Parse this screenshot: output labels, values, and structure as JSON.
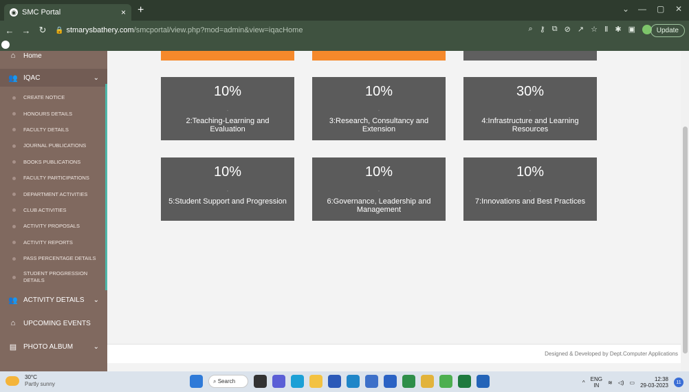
{
  "browser": {
    "tab_title": "SMC Portal",
    "tab_close": "×",
    "new_tab": "+",
    "url_domain": "stmarysbathery.com",
    "url_path": "/smcportal/view.php?mod=admin&view=iqacHome",
    "update_label": "Update",
    "window_controls": {
      "chevron": "⌄",
      "minimize": "—",
      "maximize": "▢",
      "close": "✕"
    }
  },
  "sidebar": {
    "home_label": "Home",
    "iqac_label": "IQAC",
    "iqac_items": [
      "CREATE NOTICE",
      "HONOURS DETAILS",
      "FACULTY DETAILS",
      "JOURNAL PUBLICATIONS",
      "BOOKS PUBLICATIONS",
      "FACULTY PARTICIPATIONS",
      "DEPARTMENT ACTIVITIES",
      "CLUB ACTIVITIES",
      "ACTIVITY PROPOSALS",
      "ACTIVITY REPORTS",
      "PASS PERCENTAGE DETAILS",
      "STUDENT PROGRESSION DETAILS"
    ],
    "activity_details_label": "ACTIVITY DETAILS",
    "upcoming_events_label": "UPCOMING EVENTS",
    "photo_album_label": "PHOTO ALBUM"
  },
  "main": {
    "criteria": [
      {
        "percent": "10%",
        "separator": "-",
        "name": "2:Teaching-Learning and Evaluation"
      },
      {
        "percent": "10%",
        "separator": "-",
        "name": "3:Research, Consultancy and Extension"
      },
      {
        "percent": "30%",
        "separator": "-",
        "name": "4:Infrastructure and Learning Resources"
      },
      {
        "percent": "10%",
        "separator": "-",
        "name": "5:Student Support and Progression"
      },
      {
        "percent": "10%",
        "separator": "-",
        "name": "6:Governance, Leadership and Management"
      },
      {
        "percent": "10%",
        "separator": "-",
        "name": "7:Innovations and Best Practices"
      }
    ],
    "footer": "Designed & Developed by Dept.Computer Applications"
  },
  "taskbar": {
    "temperature": "30°C",
    "weather": "Partly sunny",
    "search_label": "Search",
    "lang_top": "ENG",
    "lang_bottom": "IN",
    "time": "12:38",
    "date": "29-03-2023",
    "notification_count": "11"
  },
  "colors": {
    "sidebar_bg": "#80695f",
    "card_bg": "#5b5b5b",
    "orange_accent": "#f5892b",
    "browser_chrome": "#3f5240"
  }
}
